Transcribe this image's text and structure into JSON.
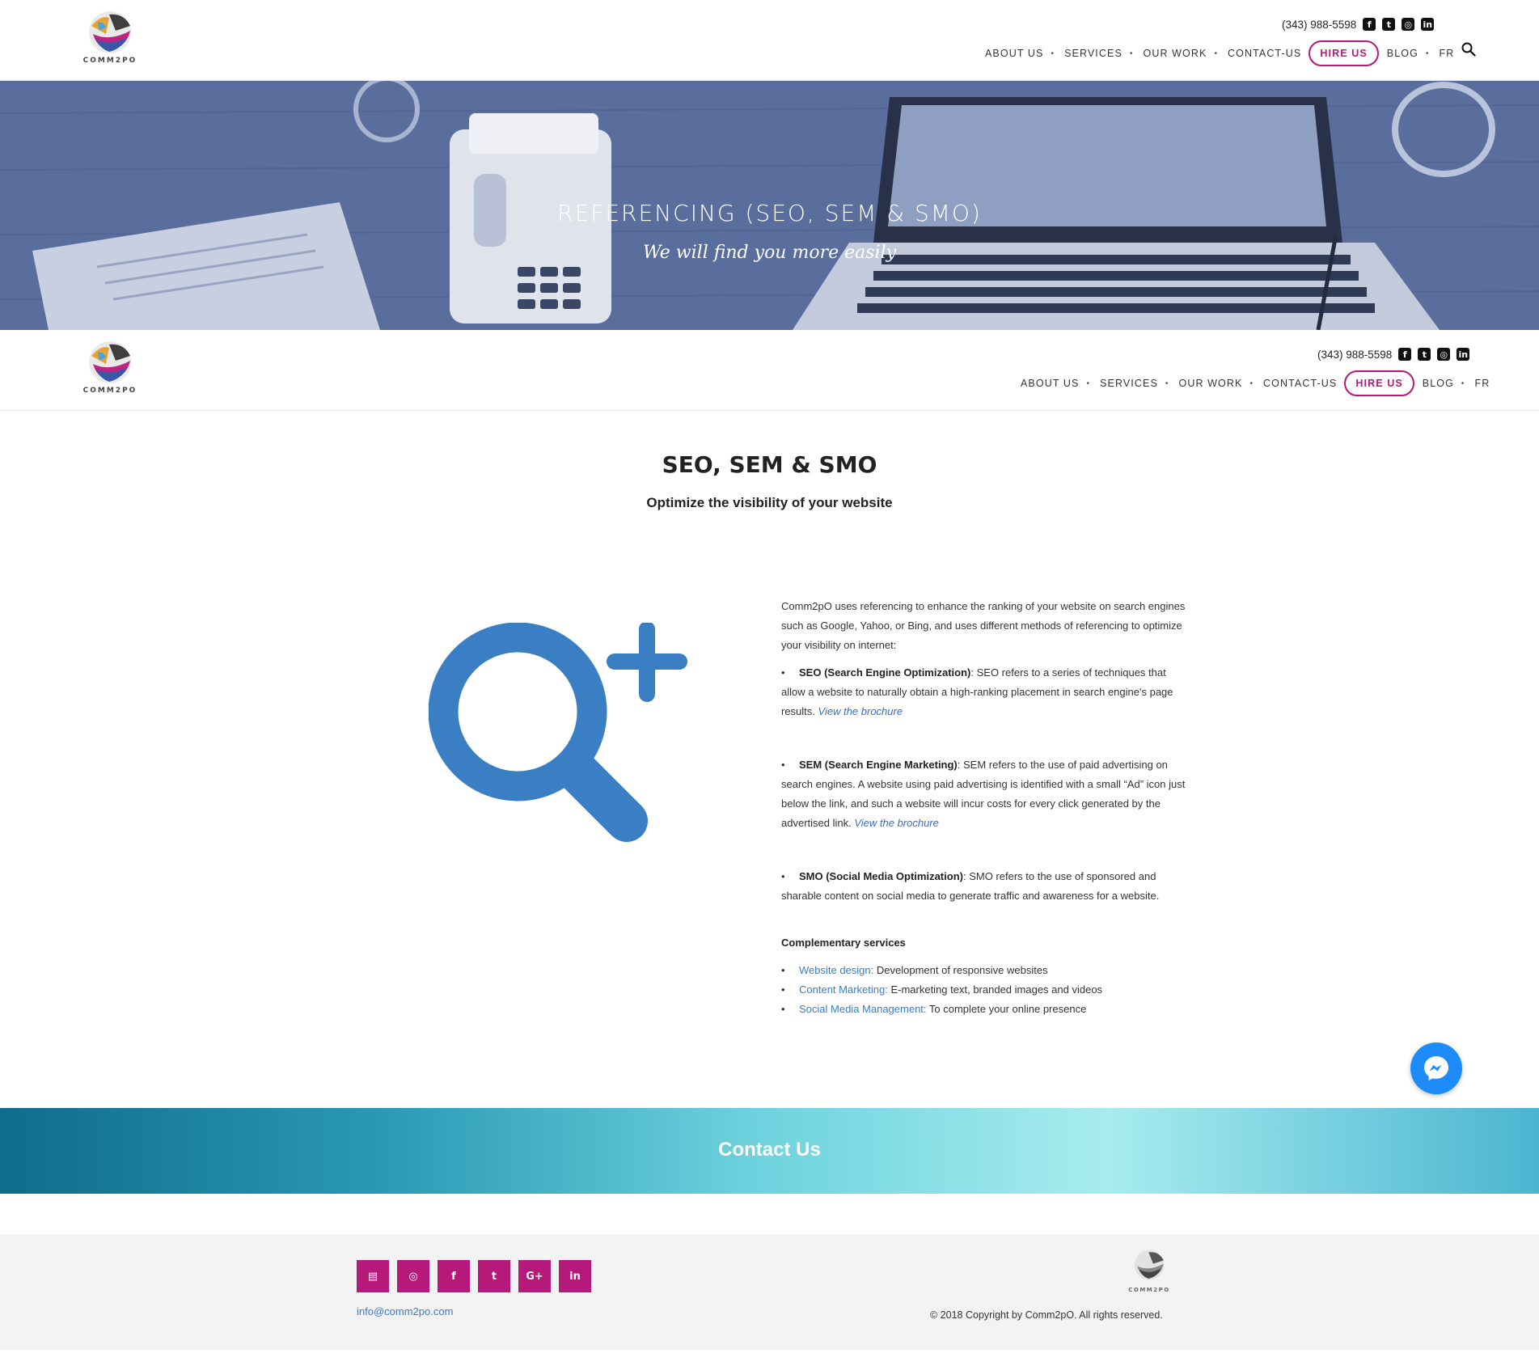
{
  "brand": {
    "name": "Comm2pO",
    "logo_text": "COMM2PO",
    "accent": "#b5197a",
    "link_color": "#3a7bc8"
  },
  "header": {
    "phone": "(343) 988-5598",
    "social": [
      "facebook-icon",
      "twitter-icon",
      "instagram-icon",
      "linkedin-icon"
    ],
    "nav": {
      "about": "ABOUT US",
      "services": "SERVICES",
      "work": "OUR WORK",
      "contact": "CONTACT-US",
      "hire": "HIRE US",
      "blog": "BLOG",
      "lang": "FR"
    }
  },
  "hero": {
    "title": "REFERENCING (SEO, SEM & SMO)",
    "subtitle": "We will find you more easily"
  },
  "section": {
    "title": "SEO, SEM & SMO",
    "subtitle": "Optimize the visibility of your website"
  },
  "content": {
    "intro": "Comm2pO uses referencing to enhance the ranking of your website  on search engines such as Google, Yahoo, or Bing, and uses different methods of referencing to optimize your visibility on internet:",
    "seo_label": "SEO (Search Engine Optimization)",
    "seo_text": ": SEO refers to a series of techniques that allow a website to naturally obtain a high-ranking placement in search engine's page results.",
    "sem_label": "SEM (Search Engine Marketing)",
    "sem_text": ": SEM refers to the use of paid advertising on search engines. A website using paid advertising is identified with a small “Ad” icon just below the link, and such a website will incur costs for every click generated by the advertised link.",
    "smo_label": "SMO (Social Media Optimization)",
    "smo_text": ": SMO refers to the use of sponsored and sharable content on social media to generate traffic and awareness for a website.",
    "brochure_link": "View the brochure",
    "complementary_title": "Complementary services",
    "services": [
      {
        "link": "Website design:",
        "text": " Development of responsive websites"
      },
      {
        "link": "Content Marketing:",
        "text": " E-marketing text, branded images and videos"
      },
      {
        "link": "Social Media Management:",
        "text": " To complete your online presence"
      }
    ]
  },
  "contact_band": {
    "label": "Contact Us"
  },
  "footer": {
    "icons": [
      "newsletter-icon",
      "instagram-icon",
      "facebook-icon",
      "twitter-icon",
      "google-plus-icon",
      "linkedin-icon"
    ],
    "email": "info@comm2po.com",
    "copyright": "© 2018 Copyright by Comm2pO. All rights reserved."
  }
}
